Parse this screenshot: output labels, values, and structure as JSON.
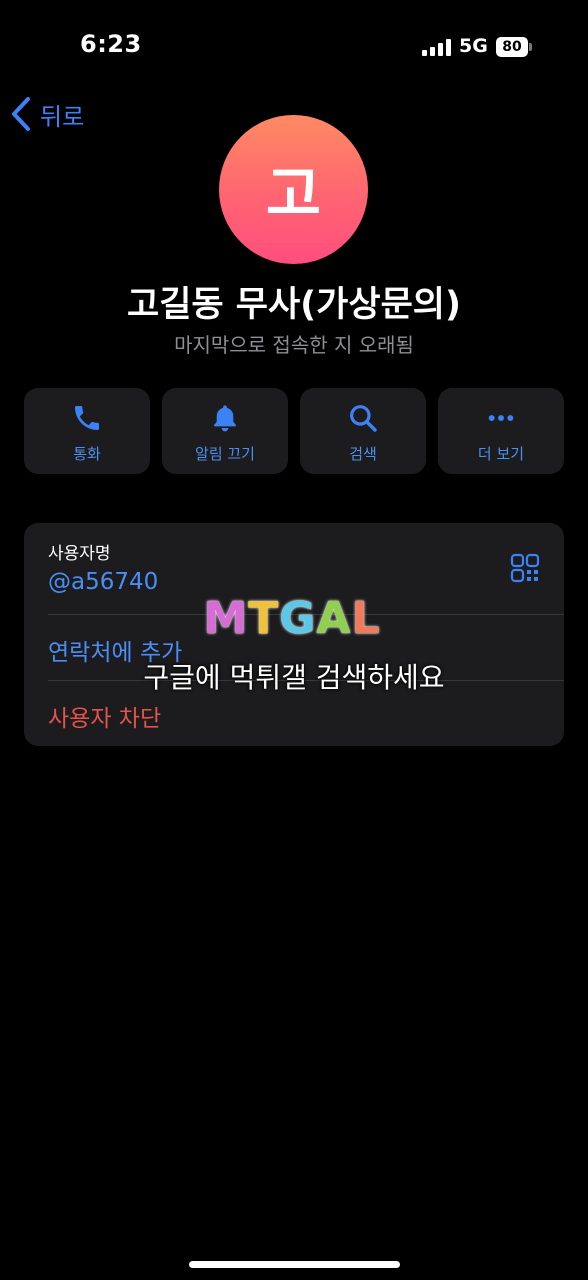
{
  "status_bar": {
    "time": "6:23",
    "network": "5G",
    "battery": "80"
  },
  "nav": {
    "back_label": "뒤로"
  },
  "profile": {
    "avatar_initial": "고",
    "name": "고길동 무사(가상문의)",
    "last_seen": "마지막으로 접속한 지 오래됨"
  },
  "actions": [
    {
      "label": "통화",
      "icon": "phone-icon"
    },
    {
      "label": "알림 끄기",
      "icon": "bell-icon"
    },
    {
      "label": "검색",
      "icon": "search-icon"
    },
    {
      "label": "더 보기",
      "icon": "more-icon"
    }
  ],
  "info": {
    "username_label": "사용자명",
    "username": "@a56740",
    "add_contact": "연락처에 추가",
    "block_user": "사용자 차단"
  },
  "watermark": {
    "logo": "MTGAL",
    "text": "구글에 먹튀갤 검색하세요"
  },
  "colors": {
    "accent": "#3b82f6",
    "danger": "#e3534b",
    "card": "#1c1c1e"
  }
}
